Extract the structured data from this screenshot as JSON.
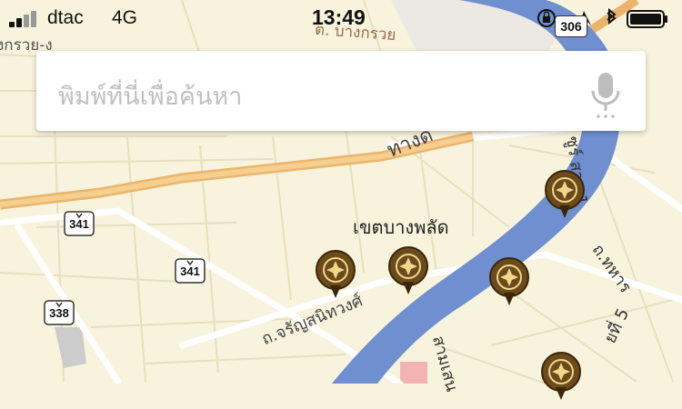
{
  "status_bar": {
    "carrier": "dtac",
    "network": "4G",
    "time": "13:49",
    "route_badge": "306"
  },
  "search": {
    "placeholder": "พิมพ์ที่นี่เพื่อค้นหา",
    "mic_icon": "microphone-icon"
  },
  "map": {
    "river_color": "#6f8fd0",
    "highway_color": "#f2c07a",
    "land_color": "#f8f3dc",
    "labels": {
      "district_top": "ต. บางกรวย",
      "district_top_left": "งกรวย-ง",
      "district": "เขตบางพลัด",
      "highway": "ทางด่",
      "road_charan": "ถ.จรัญสนิทวงศ์",
      "soi_1": "ซูร์ สาย 1",
      "road_thahan": "ถ.ทหาร",
      "samsen": "สามเสน",
      "soi_5": "ยที่ 5"
    },
    "route_shields": [
      "341",
      "341",
      "338"
    ],
    "pin_icon": "temple-pin-icon",
    "pin_color": "#6b4a1c"
  }
}
